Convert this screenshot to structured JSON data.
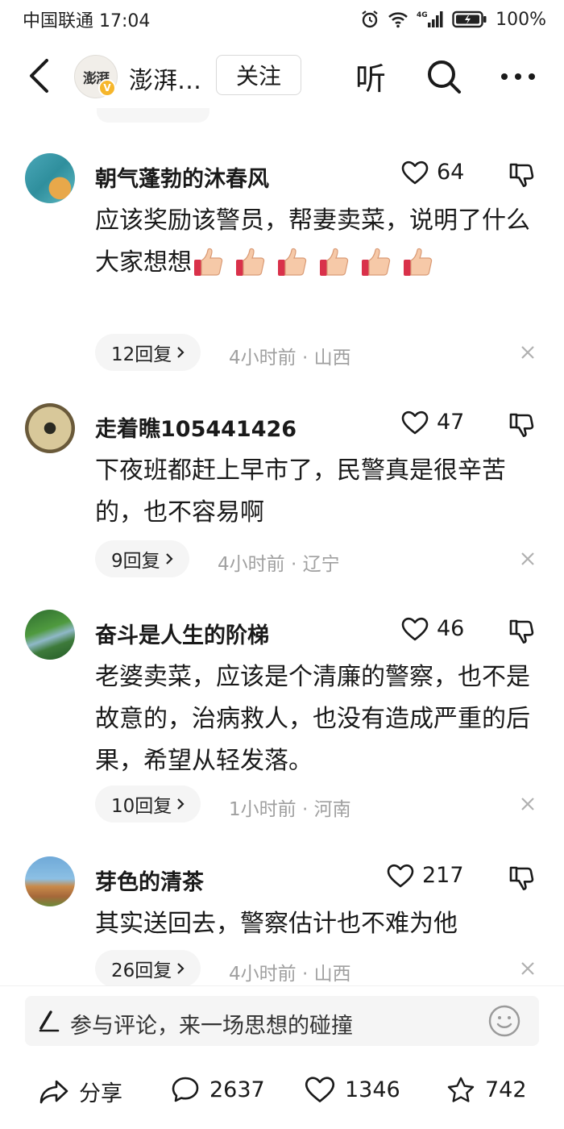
{
  "status_bar": {
    "carrier_time": "中国联通 17:04",
    "network": "4G",
    "battery": "100%"
  },
  "header": {
    "avatar_text": "澎湃",
    "source_name": "澎湃…",
    "follow_label": "关注",
    "listen_label": "听"
  },
  "comments": [
    {
      "name": "朝气蓬勃的沐春风",
      "likes": "64",
      "text": "应该奖励该警员，帮妻卖菜，说明了什么大家想想",
      "emoji_count": 6,
      "replies": "12回复",
      "meta": "4小时前 · 山西"
    },
    {
      "name": "走着瞧105441426",
      "likes": "47",
      "text": "下夜班都赶上早市了，民警真是很辛苦的，也不容易啊",
      "replies": "9回复",
      "meta": "4小时前 · 辽宁"
    },
    {
      "name": "奋斗是人生的阶梯",
      "likes": "46",
      "text": "老婆卖菜，应该是个清廉的警察，也不是故意的，治病救人，也没有造成严重的后果，希望从轻发落。",
      "replies": "10回复",
      "meta": "1小时前 · 河南"
    },
    {
      "name": "芽色的清茶",
      "likes": "217",
      "text": "其实送回去，警察估计也不难为他",
      "replies": "26回复",
      "meta": "4小时前 · 山西"
    }
  ],
  "input": {
    "placeholder": "参与评论，来一场思想的碰撞"
  },
  "bottom_bar": {
    "share_label": "分享",
    "comments_count": "2637",
    "likes_count": "1346",
    "favorites_count": "742"
  }
}
